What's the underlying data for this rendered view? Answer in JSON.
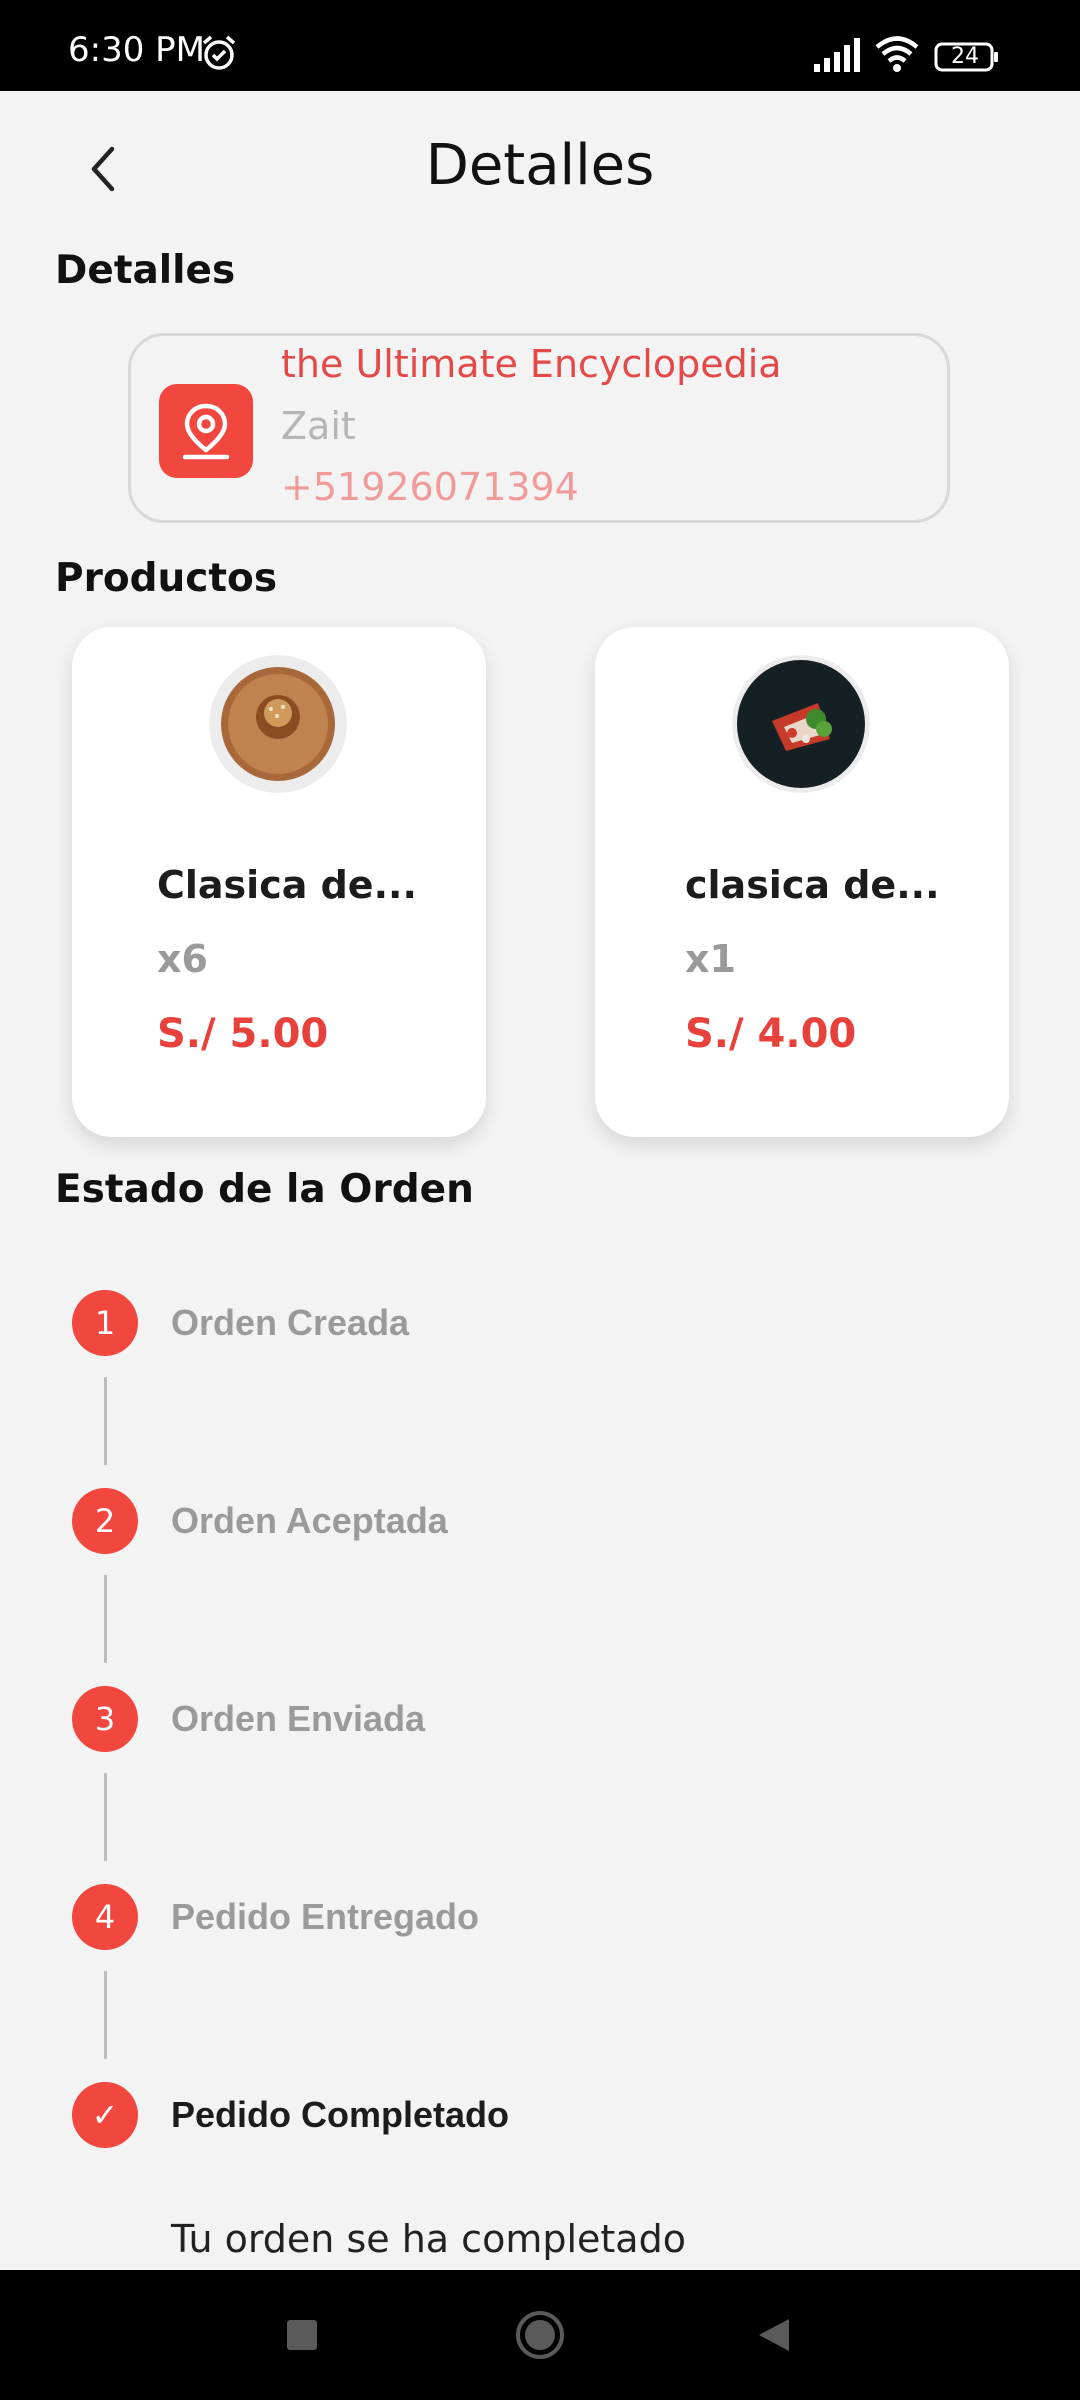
{
  "status_bar": {
    "time": "6:30 PM",
    "battery": "24",
    "icons": [
      "alarm-icon",
      "signal-icon",
      "wifi-icon",
      "battery-icon"
    ]
  },
  "header": {
    "title": "Detalles",
    "back_icon": "chevron-left-icon"
  },
  "details": {
    "section_title": "Detalles",
    "address": "the Ultimate Encyclopedia",
    "name": "Zait",
    "phone": "+51926071394",
    "icon": "location-pin-icon"
  },
  "products": {
    "section_title": "Productos",
    "items": [
      {
        "name": "Clasica de...",
        "qty": "x6",
        "price": "S./ 5.00"
      },
      {
        "name": "clasica de...",
        "qty": "x1",
        "price": "S./ 4.00"
      }
    ]
  },
  "order_status": {
    "section_title": "Estado de la Orden",
    "steps": [
      {
        "number": "1",
        "label": "Orden Creada"
      },
      {
        "number": "2",
        "label": "Orden Aceptada"
      },
      {
        "number": "3",
        "label": "Orden Enviada"
      },
      {
        "number": "4",
        "label": "Pedido Entregado"
      },
      {
        "number": "✓",
        "label": "Pedido Completado"
      }
    ],
    "completed_message": "Tu orden se ha completado"
  },
  "colors": {
    "accent": "#f2473f",
    "background": "#f3f3f3",
    "muted_text": "#9a9a9a"
  }
}
